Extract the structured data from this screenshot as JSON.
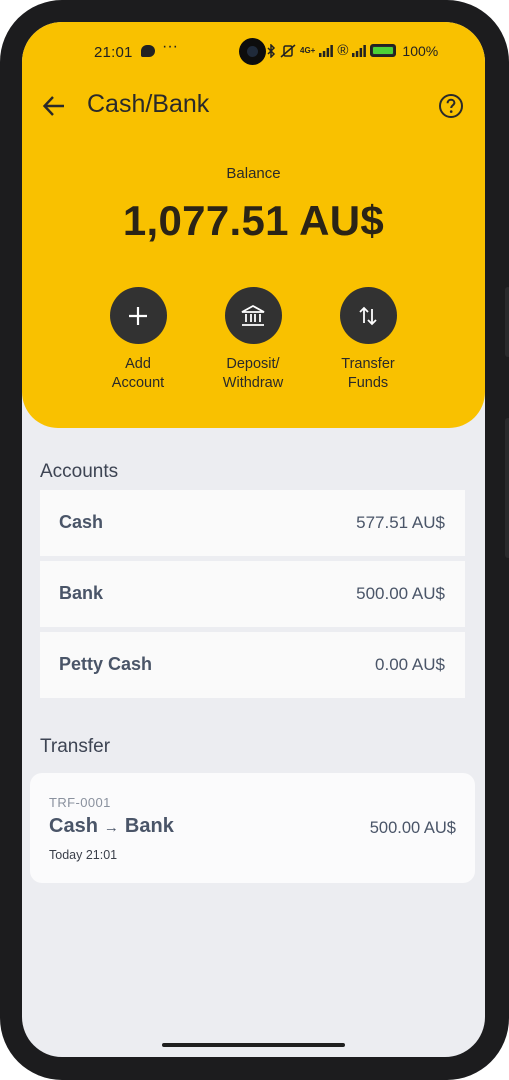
{
  "status_bar": {
    "time": "21:01",
    "dots": "···",
    "network": "4G+",
    "registered": "®",
    "battery": "100%"
  },
  "header": {
    "title": "Cash/Bank",
    "back_icon": "arrow-left-icon",
    "help_icon": "help-circle-icon"
  },
  "balance": {
    "label": "Balance",
    "value": "1,077.51 AU$"
  },
  "actions": [
    {
      "line1": "Add",
      "line2": "Account",
      "icon": "plus-icon"
    },
    {
      "line1": "Deposit/",
      "line2": "Withdraw",
      "icon": "bank-icon"
    },
    {
      "line1": "Transfer",
      "line2": "Funds",
      "icon": "swap-vertical-icon"
    }
  ],
  "accounts": {
    "title": "Accounts",
    "items": [
      {
        "name": "Cash",
        "amount": "577.51 AU$"
      },
      {
        "name": "Bank",
        "amount": "500.00 AU$"
      },
      {
        "name": "Petty Cash",
        "amount": "0.00 AU$"
      }
    ]
  },
  "transfers": {
    "title": "Transfer",
    "items": [
      {
        "id": "TRF-0001",
        "from": "Cash",
        "arrow": "→",
        "to": "Bank",
        "date": "Today 21:01",
        "amount": "500.00 AU$"
      }
    ]
  },
  "colors": {
    "accent": "#f9c100",
    "button_dark": "#323232",
    "background": "#ecedf1"
  }
}
